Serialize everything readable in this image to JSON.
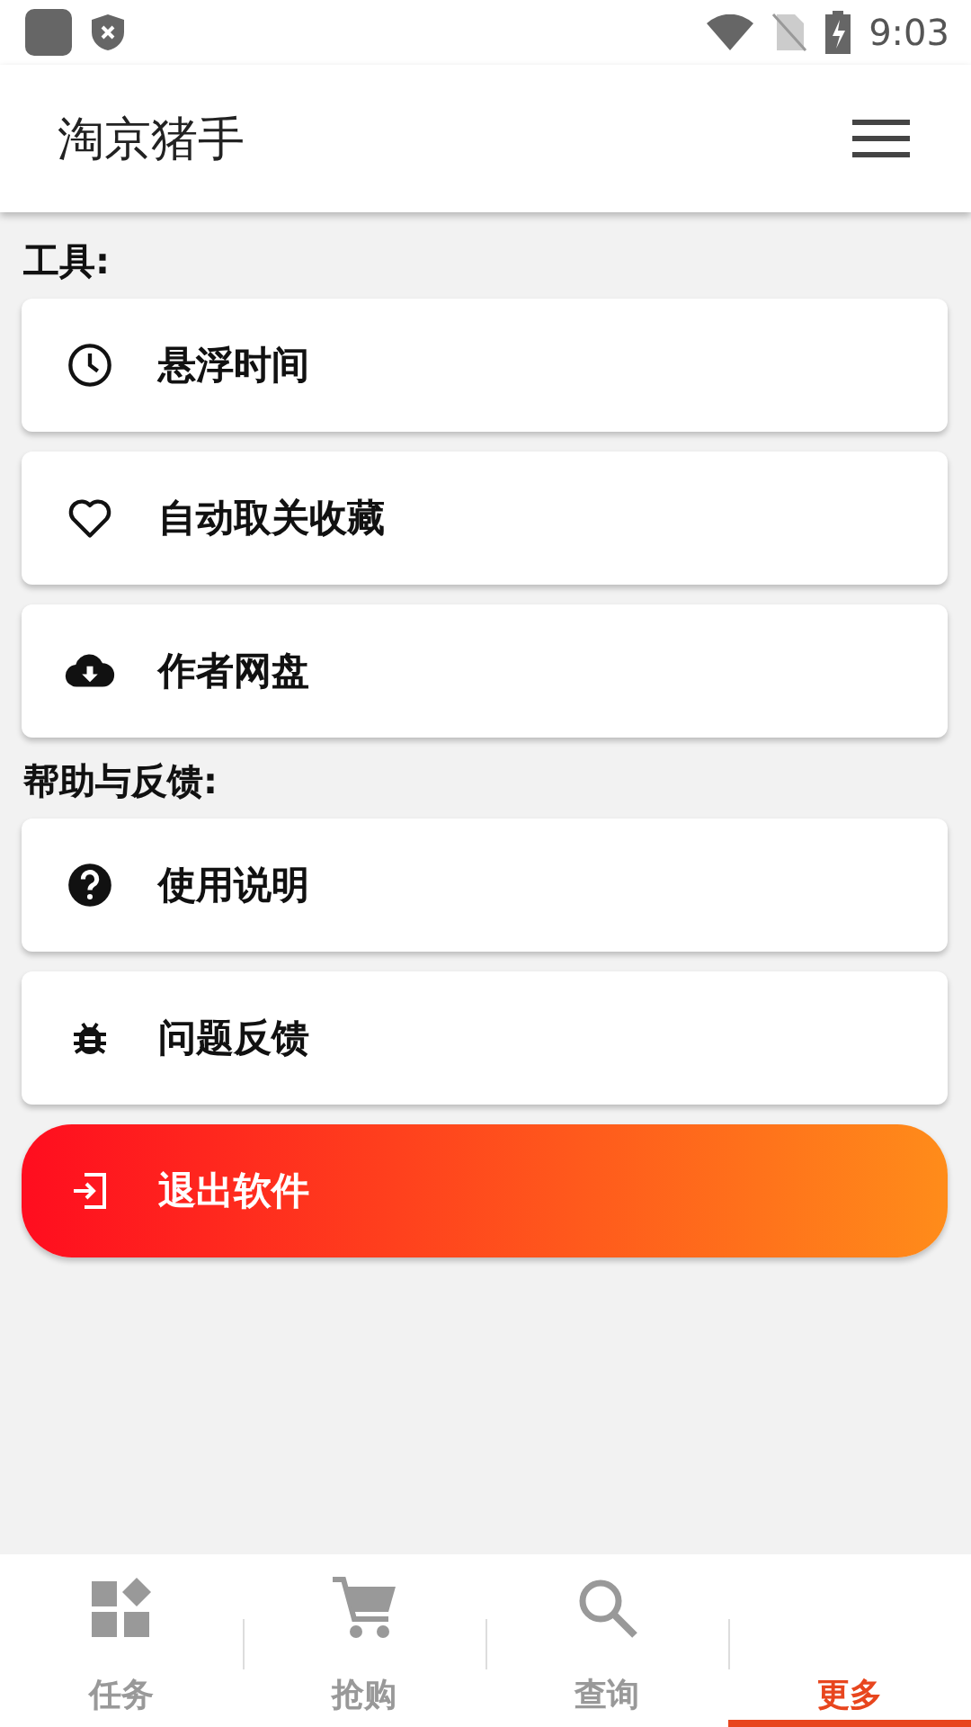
{
  "status_bar": {
    "time": "9:03"
  },
  "app_bar": {
    "title": "淘京猪手"
  },
  "sections": [
    {
      "title": "工具:",
      "items": [
        {
          "kind": "clock",
          "label": "悬浮时间"
        },
        {
          "kind": "heart",
          "label": "自动取关收藏"
        },
        {
          "kind": "cloud",
          "label": "作者网盘"
        }
      ]
    },
    {
      "title": "帮助与反馈:",
      "items": [
        {
          "kind": "help",
          "label": "使用说明"
        },
        {
          "kind": "bug",
          "label": "问题反馈"
        }
      ]
    }
  ],
  "exit_button": {
    "label": "退出软件"
  },
  "bottom_nav": [
    {
      "kind": "grid",
      "label": "任务",
      "selected": false
    },
    {
      "kind": "cart",
      "label": "抢购",
      "selected": false
    },
    {
      "kind": "search",
      "label": "查询",
      "selected": false
    },
    {
      "kind": "none",
      "label": "更多",
      "selected": true
    }
  ]
}
